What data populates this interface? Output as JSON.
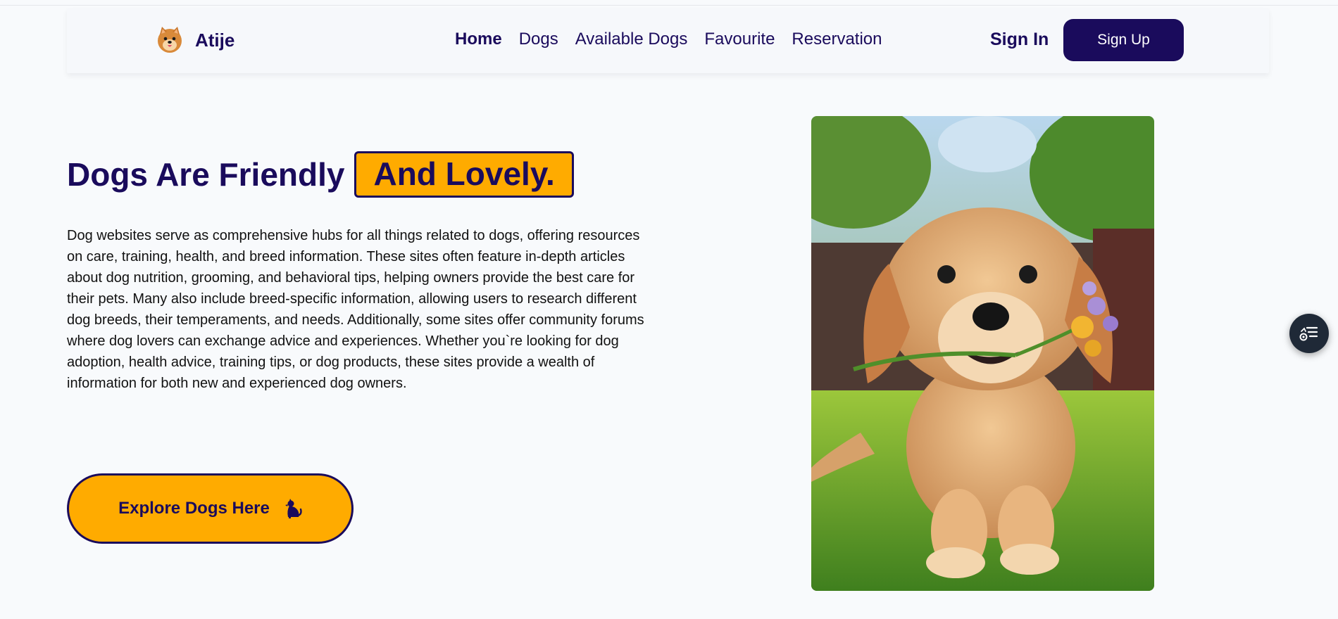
{
  "brand": {
    "name": "Atije",
    "logo_icon": "pomeranian-dog-face-icon"
  },
  "nav": {
    "links": [
      {
        "label": "Home",
        "active": true
      },
      {
        "label": "Dogs",
        "active": false
      },
      {
        "label": "Available Dogs",
        "active": false
      },
      {
        "label": "Favourite",
        "active": false
      },
      {
        "label": "Reservation",
        "active": false
      }
    ],
    "sign_in": "Sign In",
    "sign_up": "Sign Up"
  },
  "hero": {
    "title_plain": "Dogs Are Friendly",
    "title_highlight": "And Lovely.",
    "description": "Dog websites serve as comprehensive hubs for all things related to dogs, offering resources on care, training, health, and breed information. These sites often feature in-depth articles about dog nutrition, grooming, and behavioral tips, helping owners provide the best care for their pets. Many also include breed-specific information, allowing users to research different dog breeds, their temperaments, and needs. Additionally, some sites offer community forums where dog lovers can exchange advice and experiences. Whether you`re looking for dog adoption, health advice, training tips, or dog products, these sites provide a wealth of information for both new and experienced dog owners.",
    "cta_label": "Explore Dogs Here",
    "cta_icon": "sitting-dog-icon",
    "image": "golden-retriever-puppy-photo"
  },
  "floating_button": {
    "icon": "accessibility-menu-icon"
  },
  "colors": {
    "primary": "#1a0b5c",
    "accent": "#ffab00",
    "background": "#f8fafc",
    "float_button": "#1f2937"
  }
}
